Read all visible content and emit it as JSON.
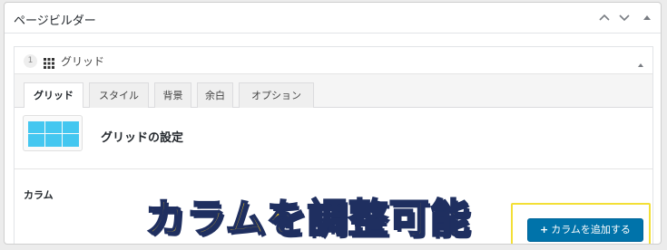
{
  "panel": {
    "title": "ページビルダー",
    "controls": [
      "chevron-up-icon",
      "chevron-down-icon",
      "collapse-triangle-icon"
    ]
  },
  "block": {
    "number": "1",
    "icon": "grid-icon",
    "title": "グリッド",
    "toggle_icon": "collapse-triangle-icon"
  },
  "tabs": [
    {
      "label": "グリッド",
      "active": true
    },
    {
      "label": "スタイル",
      "active": false
    },
    {
      "label": "背景",
      "active": false
    },
    {
      "label": "余白",
      "active": false
    },
    {
      "label": "オプション",
      "active": false
    }
  ],
  "grid_settings": {
    "title": "グリッドの設定",
    "thumbnail_icon": "grid-layout-icon",
    "thumbnail_color": "#44c7f0"
  },
  "columns": {
    "label": "カラム",
    "add_button_label": "カラムを追加する",
    "add_button_icon": "plus-icon"
  },
  "overlay": {
    "caption": "カラムを調整可能",
    "caption_color": "#ffd21f",
    "highlight_color": "#f3df36"
  },
  "colors": {
    "accent": "#0073aa"
  }
}
